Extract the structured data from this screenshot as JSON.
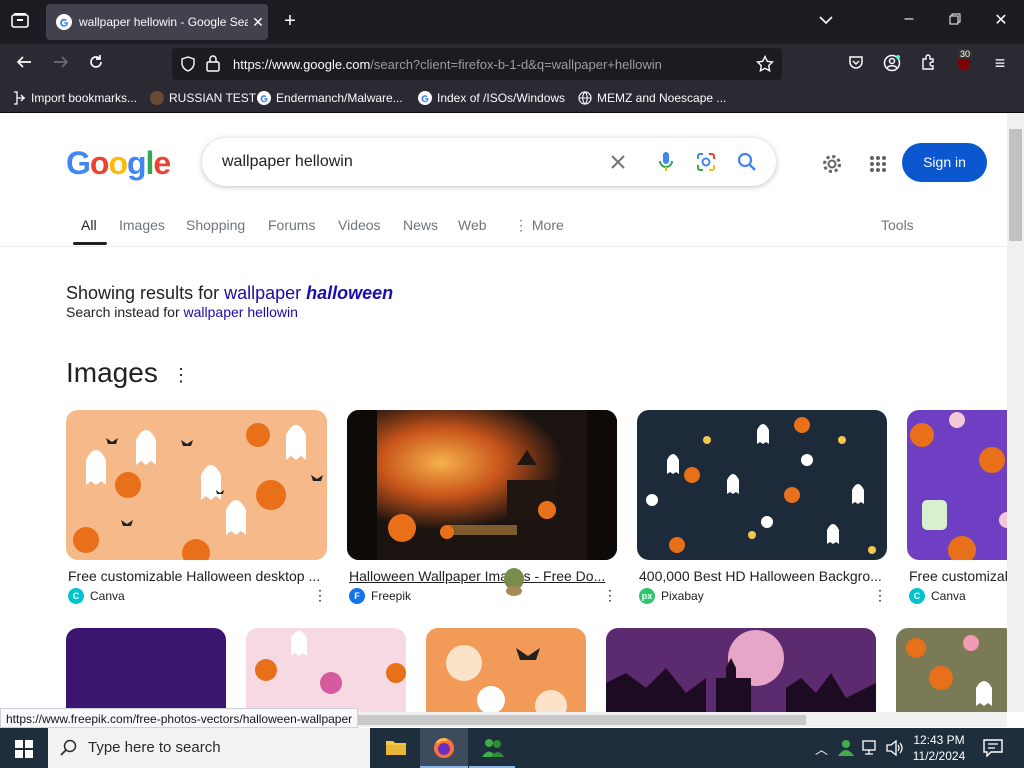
{
  "browser": {
    "tab_title": "wallpaper hellowin - Google Search",
    "url_host": "https://www.google.com",
    "url_rest": "/search?client=firefox-b-1-d&q=wallpaper+hellowin",
    "extension_badge": "30",
    "bookmarks": [
      "Import bookmarks...",
      "RUSSIAN TEST",
      "Endermanch/Malware...",
      "Index of /ISOs/Windows",
      "MEMZ and Noescape ..."
    ]
  },
  "google": {
    "logo": "Google",
    "query": "wallpaper hellowin",
    "signin": "Sign in",
    "tabs": [
      "All",
      "Images",
      "Shopping",
      "Forums",
      "Videos",
      "News",
      "Web",
      "More"
    ],
    "tools": "Tools",
    "showing_prefix": "Showing results for ",
    "showing_plain": "wallpaper ",
    "showing_bold": "halloween",
    "instead_prefix": "Search instead for ",
    "instead_link": "wallpaper hellowin",
    "images_heading": "Images",
    "results": [
      {
        "title": "Free customizable Halloween desktop ...",
        "source": "Canva"
      },
      {
        "title": "Halloween Wallpaper Images - Free Do...",
        "source": "Freepik"
      },
      {
        "title": "400,000 Best HD Halloween Backgro...",
        "source": "Pixabay"
      },
      {
        "title": "Free customizab",
        "source": "Canva"
      }
    ]
  },
  "status_url": "https://www.freepik.com/free-photos-vectors/halloween-wallpaper",
  "taskbar": {
    "search_placeholder": "Type here to search",
    "time": "12:43 PM",
    "date": "11/2/2024"
  }
}
